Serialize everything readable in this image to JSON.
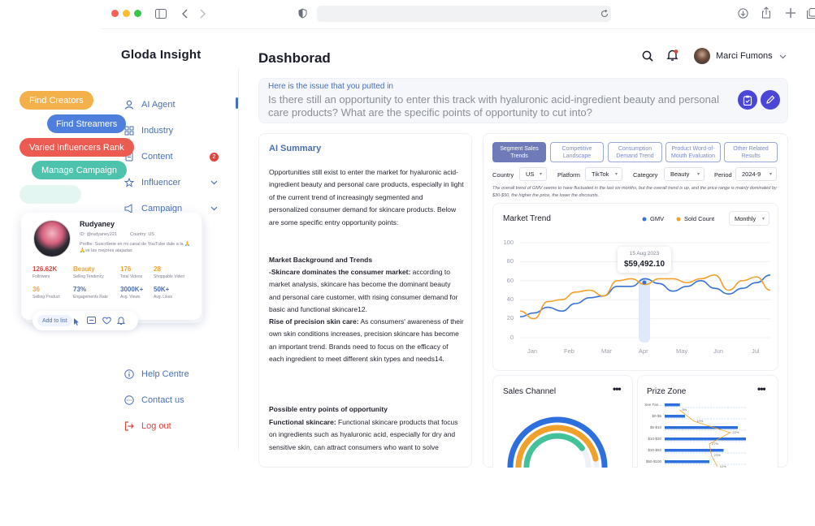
{
  "browser": {
    "colors": [
      "#f25f58",
      "#fbbc2e",
      "#34c749"
    ]
  },
  "sidebar": {
    "brand": "Gloda Insight",
    "items": [
      {
        "label": "AI Agent",
        "icon": "user-icon"
      },
      {
        "label": "Industry",
        "icon": "grid-icon"
      },
      {
        "label": "Content",
        "icon": "document-icon",
        "badge": "2"
      },
      {
        "label": "Influencer",
        "icon": "star-icon"
      },
      {
        "label": "Campaign",
        "icon": "megaphone-icon"
      }
    ],
    "bottom": [
      {
        "label": "Help Centre",
        "icon": "info-icon"
      },
      {
        "label": "Contact us",
        "icon": "chat-icon"
      },
      {
        "label": "Log out",
        "icon": "logout-icon"
      }
    ]
  },
  "floating": {
    "pills": [
      {
        "label": "Find Creators",
        "color": "#f4b04a"
      },
      {
        "label": "Find Streamers",
        "color": "#4e7fdc"
      },
      {
        "label": "Varied Influencers Rank",
        "color": "#ec5b52"
      },
      {
        "label": "Manage Campaign",
        "color": "#4dc2ac"
      }
    ],
    "card": {
      "name": "Rudyaney",
      "id": "ID: @rudyaney221",
      "country": "Country: US",
      "profile": "Profile: Suscríbete en mi canal de YouTube dale a la 🙏🙏ve las mejores atajadas",
      "stats": [
        {
          "value": "126.62K",
          "label": "Followers",
          "color": "#e0443e"
        },
        {
          "value": "Beauty",
          "label": "Selling Tendency",
          "color": "#f4a43a"
        },
        {
          "value": "176",
          "label": "Total Videos",
          "color": "#f4a43a"
        },
        {
          "value": "28",
          "label": "Shoppable Video",
          "color": "#f4a43a"
        },
        {
          "value": "36",
          "label": "Selling Product",
          "color": "#f4a43a"
        },
        {
          "value": "73%",
          "label": "Engagements Rate",
          "color": "#4a6fb5"
        },
        {
          "value": "3000K+",
          "label": "Avg. Views",
          "color": "#4a6fb5"
        },
        {
          "value": "50K+",
          "label": "Avg. Likes",
          "color": "#4a6fb5"
        }
      ],
      "add_to_list": "Add to list"
    }
  },
  "header": {
    "title": "Dashborad",
    "user_name": "Marci Fumons"
  },
  "question": {
    "label": "Here is the issue that you putted in",
    "text": "Is there still an opportunity to enter this track with hyaluronic acid-ingredient beauty and personal care products? What are the specific points of opportunity to cut into?"
  },
  "summary": {
    "title": "AI Summary",
    "intro": "Opportunities still exist to enter the market for hyaluronic acid-ingredient beauty and personal care products, especially in light of the current trend of increasingly segmented and personalized consumer demand for skincare products. Below are some specific entry opportunity points:",
    "section1_title": "Market Background and Trends",
    "s1_a_bold": "-Skincare dominates the consumer market:",
    "s1_a_text": " according to market analysis, skincare has become the dominant beauty and personal care customer, with rising consumer demand for basic and functional skincare12.",
    "s1_b_bold": "Rise of precision skin care:",
    "s1_b_text": " As consumers' awareness of their own skin conditions increases, precision skincare has become an important trend. Brands need to focus on the efficacy of each ingredient to meet different skin types and needs14.",
    "section2_title": "Possible entry points of opportunity",
    "s2_a_bold": "Functional skincare:",
    "s2_a_text": " Functional skincare products that focus on ingredients such as hyaluronic acid, especially for dry and sensitive skin, can attract consumers who want to solve"
  },
  "tabs": [
    "Segment Sales Trends",
    "Competitive Landscape",
    "Consumption Demand Trend",
    "Product Word-of-Mouth Evaluation",
    "Other Related Results"
  ],
  "filters": [
    {
      "label": "Country",
      "value": "US"
    },
    {
      "label": "Platform",
      "value": "TikTok"
    },
    {
      "label": "Category",
      "value": "Beauty"
    },
    {
      "label": "Period",
      "value": "2024-9"
    }
  ],
  "note": "The overall trend of GMV seems to have fluctuated in the last six months, but the overall trend is up, and the price range is mainly dominated by $30-$50, the higher the price, the lower the discounts.",
  "market_trend": {
    "title": "Market Trend",
    "legend": [
      "GMV",
      "Sold Count"
    ],
    "range": "Monthly",
    "tooltip_date": "15 Aug 2023",
    "tooltip_value": "$59,492.10",
    "colors": {
      "gmv": "#3a73d6",
      "sold": "#f2a02c"
    }
  },
  "chart_data": [
    {
      "type": "line",
      "title": "Market Trend",
      "categories": [
        "Jan",
        "Feb",
        "Mar",
        "Apr",
        "May",
        "Jun",
        "Jul"
      ],
      "ylim": [
        0,
        100
      ],
      "yticks": [
        0,
        20,
        40,
        60,
        80,
        100
      ],
      "series": [
        {
          "name": "GMV",
          "values": [
            22,
            26,
            32,
            28,
            36,
            42,
            44,
            54,
            54,
            62,
            57,
            49,
            54,
            60,
            52,
            46,
            52,
            58,
            66
          ]
        },
        {
          "name": "Sold Count",
          "values": [
            28,
            20,
            38,
            40,
            48,
            50,
            44,
            60,
            62,
            56,
            62,
            62,
            58,
            62,
            66,
            50,
            60,
            64,
            50
          ]
        }
      ]
    },
    {
      "type": "pie",
      "title": "Sales Channel",
      "series": [
        {
          "name": "",
          "values": [
            0.62,
            0.55,
            0.48
          ]
        }
      ]
    },
    {
      "type": "bar",
      "title": "Prize Zone",
      "categories": [
        "See Fan...",
        "$0-$5",
        "$5-$10",
        "$10-$30",
        "$30-$50",
        "$50-$100"
      ],
      "values": [
        15,
        20,
        72,
        80,
        58,
        44
      ],
      "line_labels": [
        "5%",
        "10%",
        "22%",
        "27%",
        "23%",
        "12%"
      ]
    }
  ],
  "sales_channel": {
    "title": "Sales Channel",
    "colors": [
      "#2d6fdc",
      "#f2a02c",
      "#43c19b"
    ]
  },
  "prize_zone": {
    "title": "Prize Zone"
  }
}
